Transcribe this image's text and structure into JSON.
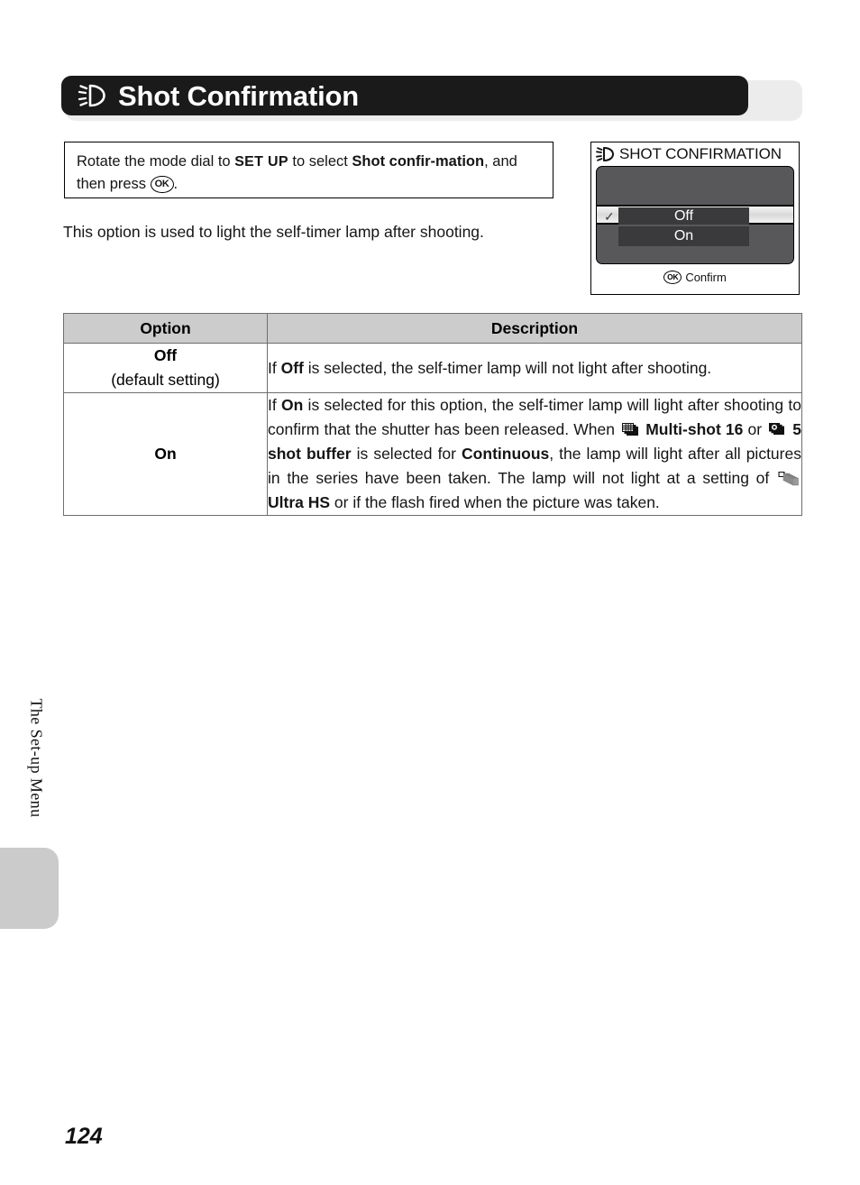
{
  "header": {
    "icon": "self-timer-lamp-icon",
    "title": "Shot Confirmation"
  },
  "instruction": {
    "part1": "Rotate the mode dial to ",
    "dial": "SET UP",
    "part2": " to select ",
    "bold1": "Shot confir-",
    "bold2": "mation",
    "part3": ", and then press ",
    "ok_glyph": "OK",
    "part4": "."
  },
  "body_paragraph": "This option is used to light the self-timer lamp after shooting.",
  "camera_screen": {
    "title_icon": "self-timer-lamp-icon",
    "title": "SHOT CONFIRMATION",
    "items": [
      {
        "label": "Off",
        "selected": true,
        "checked": true
      },
      {
        "label": "On",
        "selected": false,
        "checked": false
      }
    ],
    "footer_glyph": "OK",
    "footer_text": "Confirm"
  },
  "table": {
    "headers": [
      "Option",
      "Description"
    ],
    "rows": [
      {
        "option_name": "Off",
        "option_note": "(default setting)",
        "description_parts": [
          {
            "t": "If ",
            "b": false
          },
          {
            "t": "Off",
            "b": true
          },
          {
            "t": " is selected, the self-timer lamp will not light after shooting.",
            "b": false
          }
        ]
      },
      {
        "option_name": "On",
        "option_note": "",
        "description_parts": [
          {
            "t": "If ",
            "b": false
          },
          {
            "t": "On",
            "b": true
          },
          {
            "t": " is selected for this option, the self-timer lamp will light after shooting to confirm that the shutter has been released. When ",
            "b": false
          },
          {
            "t": "ICON:multi-shot-16",
            "b": false
          },
          {
            "t": "Multi-shot 16",
            "b": true
          },
          {
            "t": " or ",
            "b": false
          },
          {
            "t": "ICON:five-shot-buffer",
            "b": false
          },
          {
            "t": "5 shot buffer",
            "b": true
          },
          {
            "t": " is selected for ",
            "b": false
          },
          {
            "t": "Continuous",
            "b": true
          },
          {
            "t": ", the lamp will light after all pictures in the series have been taken. The lamp will not light at a setting of ",
            "b": false
          },
          {
            "t": "ICON:ultra-hs",
            "b": false
          },
          {
            "t": "Ultra HS",
            "b": true
          },
          {
            "t": " or if the flash fired when the picture was taken.",
            "b": false
          }
        ]
      }
    ]
  },
  "side_tab_label": "The Set-up Menu",
  "page_number": "124",
  "colors": {
    "header_bar": "#1a1a1a",
    "header_shadow": "#ececec",
    "table_header_bg": "#cccccc",
    "table_border": "#6e6e6e",
    "camera_screen_bg": "#58585a",
    "camera_item_bg": "#3a3a3c",
    "side_tab": "#cbcbcb"
  }
}
